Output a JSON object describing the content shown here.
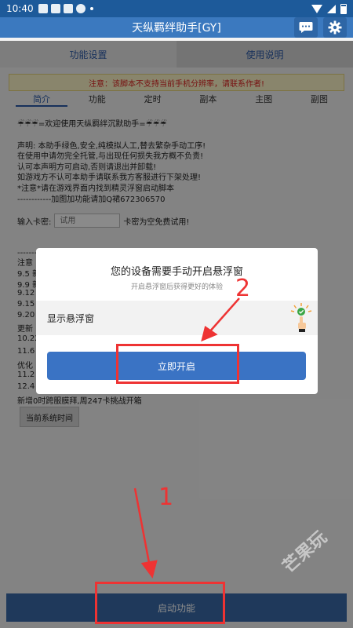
{
  "status_bar": {
    "time": "10:40"
  },
  "app": {
    "title": "天纵羁绊助手[GY]"
  },
  "tabs": [
    {
      "label": "功能设置"
    },
    {
      "label": "使用说明"
    }
  ],
  "notice": "注意：该脚本不支持当前手机分辨率，请联系作者!",
  "subtabs": [
    {
      "label": "简介"
    },
    {
      "label": "功能"
    },
    {
      "label": "定时"
    },
    {
      "label": "副本"
    },
    {
      "label": "主图"
    },
    {
      "label": "副图"
    }
  ],
  "intro": {
    "welcome": "☔☔☔=欢迎使用天纵羁绊沉默助手=☔☔☔",
    "lines": [
      "声明: 本助手绿色,安全,纯模拟人工,替去繁杂手动工序!",
      "在使用中请勿完全托管,与出现任何损失我方概不负责!",
      "认可本声明方可启动,否则请退出并卸载!",
      "如游戏方不认可本助手请联系我方客服进行下架处理!",
      "*注意*请在游戏界面内找到精灵浮窗启动脚本",
      "------------加图加功能请加Q裙672306570"
    ],
    "key_label": "输入卡密:",
    "key_placeholder": "试用",
    "key_suffix": "卡密为空免费试用!",
    "log_lines": [
      "----------------------------更新日志",
      "注意",
      "9.5 新",
      "9.9 新",
      "9.12",
      "9.15",
      "9.20",
      "更新",
      "10.22",
      "11.6",
      "优化",
      "11.2",
      "12.4",
      "新增0时跨服膜拜,周247卡挑战开箱"
    ],
    "time_button": "当前系统时间"
  },
  "dialog": {
    "title": "您的设备需要手动开启悬浮窗",
    "subtitle": "开启悬浮窗后获得更好的体验",
    "row_label": "显示悬浮窗",
    "button": "立即开启"
  },
  "start_button": "启动功能",
  "annotations": {
    "step1": "1",
    "step2": "2"
  },
  "watermark": "芒果玩",
  "colors": {
    "header": "#3b79bf",
    "status": "#1d5a9a",
    "primary_button": "#3a73c4",
    "highlight": "#e33333",
    "notice_text": "#dd2222"
  }
}
